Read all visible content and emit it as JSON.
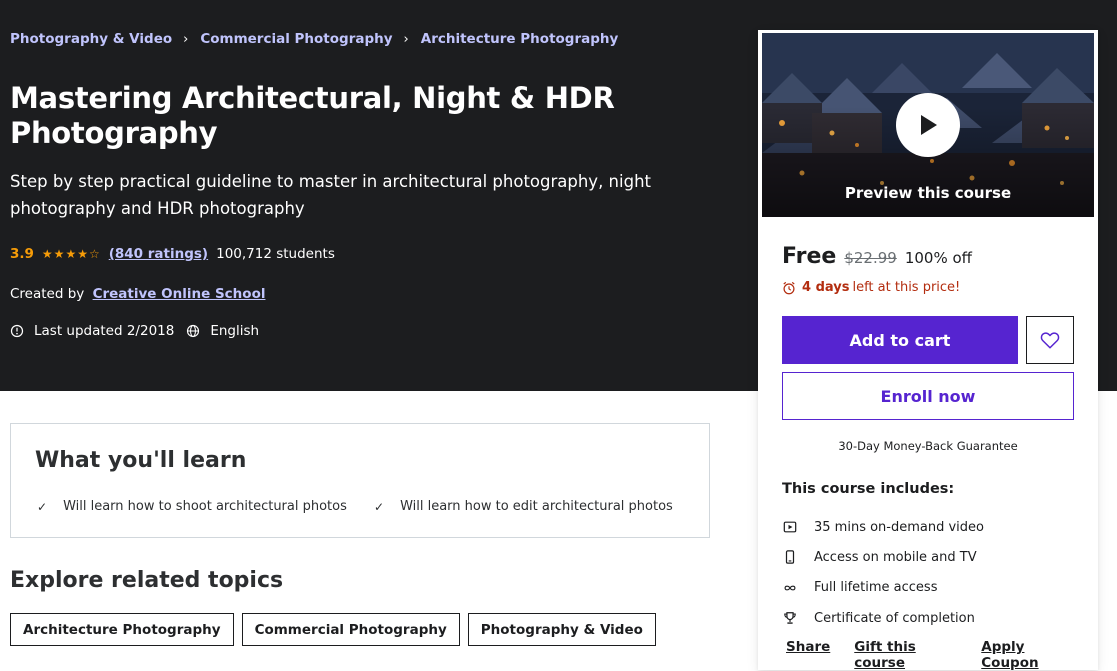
{
  "breadcrumb": [
    "Photography & Video",
    "Commercial Photography",
    "Architecture Photography"
  ],
  "breadcrumb_separator": "›",
  "course": {
    "title": "Mastering Architectural, Night & HDR Photography",
    "subtitle": "Step by step practical guideline to master in architectural photography, night photography and HDR photography",
    "rating": "3.9",
    "rating_value": 3.9,
    "stars": "★★★★☆",
    "ratings_count": "(840 ratings)",
    "students": "100,712 students",
    "created_by_label": "Created by",
    "author": "Creative Online School",
    "last_updated": "Last updated 2/2018",
    "language": "English"
  },
  "sidebar": {
    "preview_label": "Preview this course",
    "price_now": "Free",
    "price_old": "$22.99",
    "discount": "100% off",
    "timer_days": "4 days",
    "timer_rest": "left at this price!",
    "add_to_cart": "Add to cart",
    "enroll": "Enroll now",
    "guarantee": "30-Day Money-Back Guarantee",
    "includes_title": "This course includes:",
    "includes": [
      {
        "icon": "video-icon",
        "text": "35 mins on-demand video"
      },
      {
        "icon": "mobile-icon",
        "text": "Access on mobile and TV"
      },
      {
        "icon": "infinity-icon",
        "text": "Full lifetime access"
      },
      {
        "icon": "trophy-icon",
        "text": "Certificate of completion"
      }
    ],
    "actions": [
      "Share",
      "Gift this course",
      "Apply Coupon"
    ]
  },
  "learn": {
    "title": "What you'll learn",
    "items": [
      "Will learn how to shoot architectural photos",
      "Will learn how to edit architectural photos"
    ]
  },
  "explore": {
    "title": "Explore related topics",
    "topics": [
      "Architecture Photography",
      "Commercial Photography",
      "Photography & Video"
    ]
  },
  "colors": {
    "hero_bg": "#1c1d1f",
    "accent_purple": "#5624d0",
    "link_lavender": "#c0c4fc",
    "star_orange": "#f69c08",
    "timer_red": "#b32d0f"
  }
}
